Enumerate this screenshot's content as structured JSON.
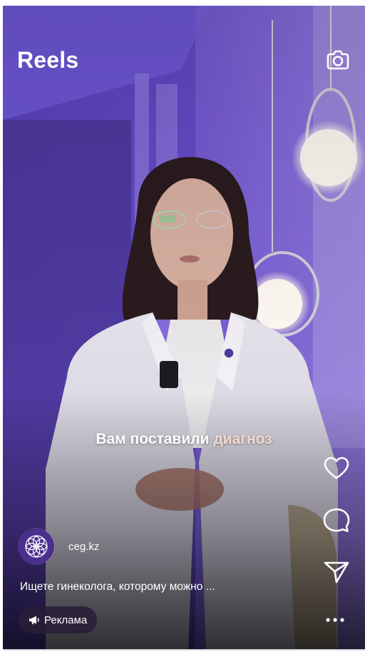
{
  "header": {
    "title": "Reels",
    "camera_icon": "camera-icon"
  },
  "video": {
    "caption_main": "Вам поставили",
    "caption_accent": "диагноз"
  },
  "actions": {
    "like_icon": "heart-icon",
    "comment_icon": "comment-icon",
    "share_icon": "send-icon",
    "more_icon": "more-dots-icon"
  },
  "account": {
    "username": "ceg.kz",
    "avatar_icon": "flower-logo-icon"
  },
  "post": {
    "description": "Ищете гинеколога, которому можно ..."
  },
  "ad": {
    "label": "Реклама",
    "icon": "megaphone-icon"
  },
  "colors": {
    "accent_caption": "#f2d9cf",
    "background_purple": "#3c2a78"
  }
}
